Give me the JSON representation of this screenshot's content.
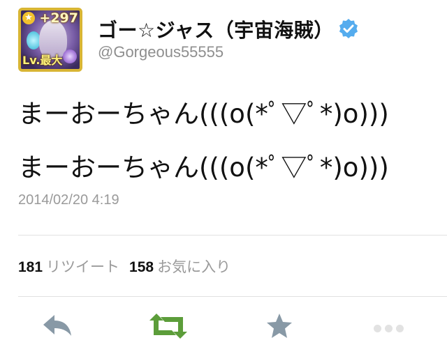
{
  "profile": {
    "display_name": "ゴー☆ジャス（宇宙海賊）",
    "handle": "@Gorgeous55555",
    "verified_icon": "verified-badge-icon",
    "avatar": {
      "plus_text": "+297",
      "level_text": "Lv.最大"
    }
  },
  "tweet": {
    "lines": [
      "まーおーちゃん(((o(*ﾟ▽ﾟ*)o)))",
      "まーおーちゃん(((o(*ﾟ▽ﾟ*)o)))"
    ],
    "timestamp": "2014/02/20 4:19"
  },
  "stats": {
    "retweets_count": "181",
    "retweets_label": "リツイート",
    "favorites_count": "158",
    "favorites_label": "お気に入り"
  },
  "actions": [
    {
      "name": "reply",
      "icon": "reply-icon"
    },
    {
      "name": "retweet",
      "icon": "retweet-icon",
      "color": "#5c9d3a"
    },
    {
      "name": "favorite",
      "icon": "star-icon"
    },
    {
      "name": "more",
      "icon": "more-dots-icon"
    }
  ],
  "colors": {
    "verified": "#55acee",
    "retweet_active": "#5c9d3a",
    "action_gray": "#8899a6",
    "muted_text": "#9a9a9a"
  }
}
